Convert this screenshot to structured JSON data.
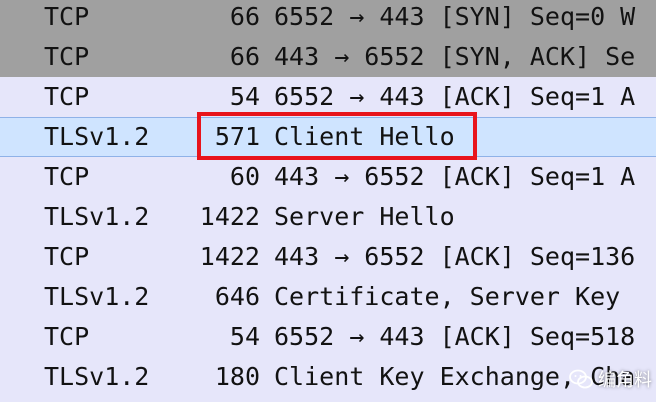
{
  "packets": [
    {
      "protocol": "TCP",
      "length": "66",
      "info": "6552 → 443 [SYN] Seq=0 W",
      "style": "gray"
    },
    {
      "protocol": "TCP",
      "length": "66",
      "info": "443 → 6552 [SYN, ACK] Se",
      "style": "gray"
    },
    {
      "protocol": "TCP",
      "length": "54",
      "info": "6552 → 443 [ACK] Seq=1 A",
      "style": "lav"
    },
    {
      "protocol": "TLSv1.2",
      "length": "571",
      "info": "Client Hello",
      "style": "sel"
    },
    {
      "protocol": "TCP",
      "length": "60",
      "info": "443 → 6552 [ACK] Seq=1 A",
      "style": "lav"
    },
    {
      "protocol": "TLSv1.2",
      "length": "1422",
      "info": "Server Hello",
      "style": "lav"
    },
    {
      "protocol": "TCP",
      "length": "1422",
      "info": "443 → 6552 [ACK] Seq=136",
      "style": "lav"
    },
    {
      "protocol": "TLSv1.2",
      "length": "646",
      "info": "Certificate, Server Key",
      "style": "lav"
    },
    {
      "protocol": "TCP",
      "length": "54",
      "info": "6552 → 443 [ACK] Seq=518",
      "style": "lav"
    },
    {
      "protocol": "TLSv1.2",
      "length": "180",
      "info": "Client Key Exchange, Cha",
      "style": "lav"
    }
  ],
  "highlight": {
    "color": "#e8141c"
  },
  "watermark": {
    "text": "编角料",
    "icon": "wechat-icon"
  }
}
